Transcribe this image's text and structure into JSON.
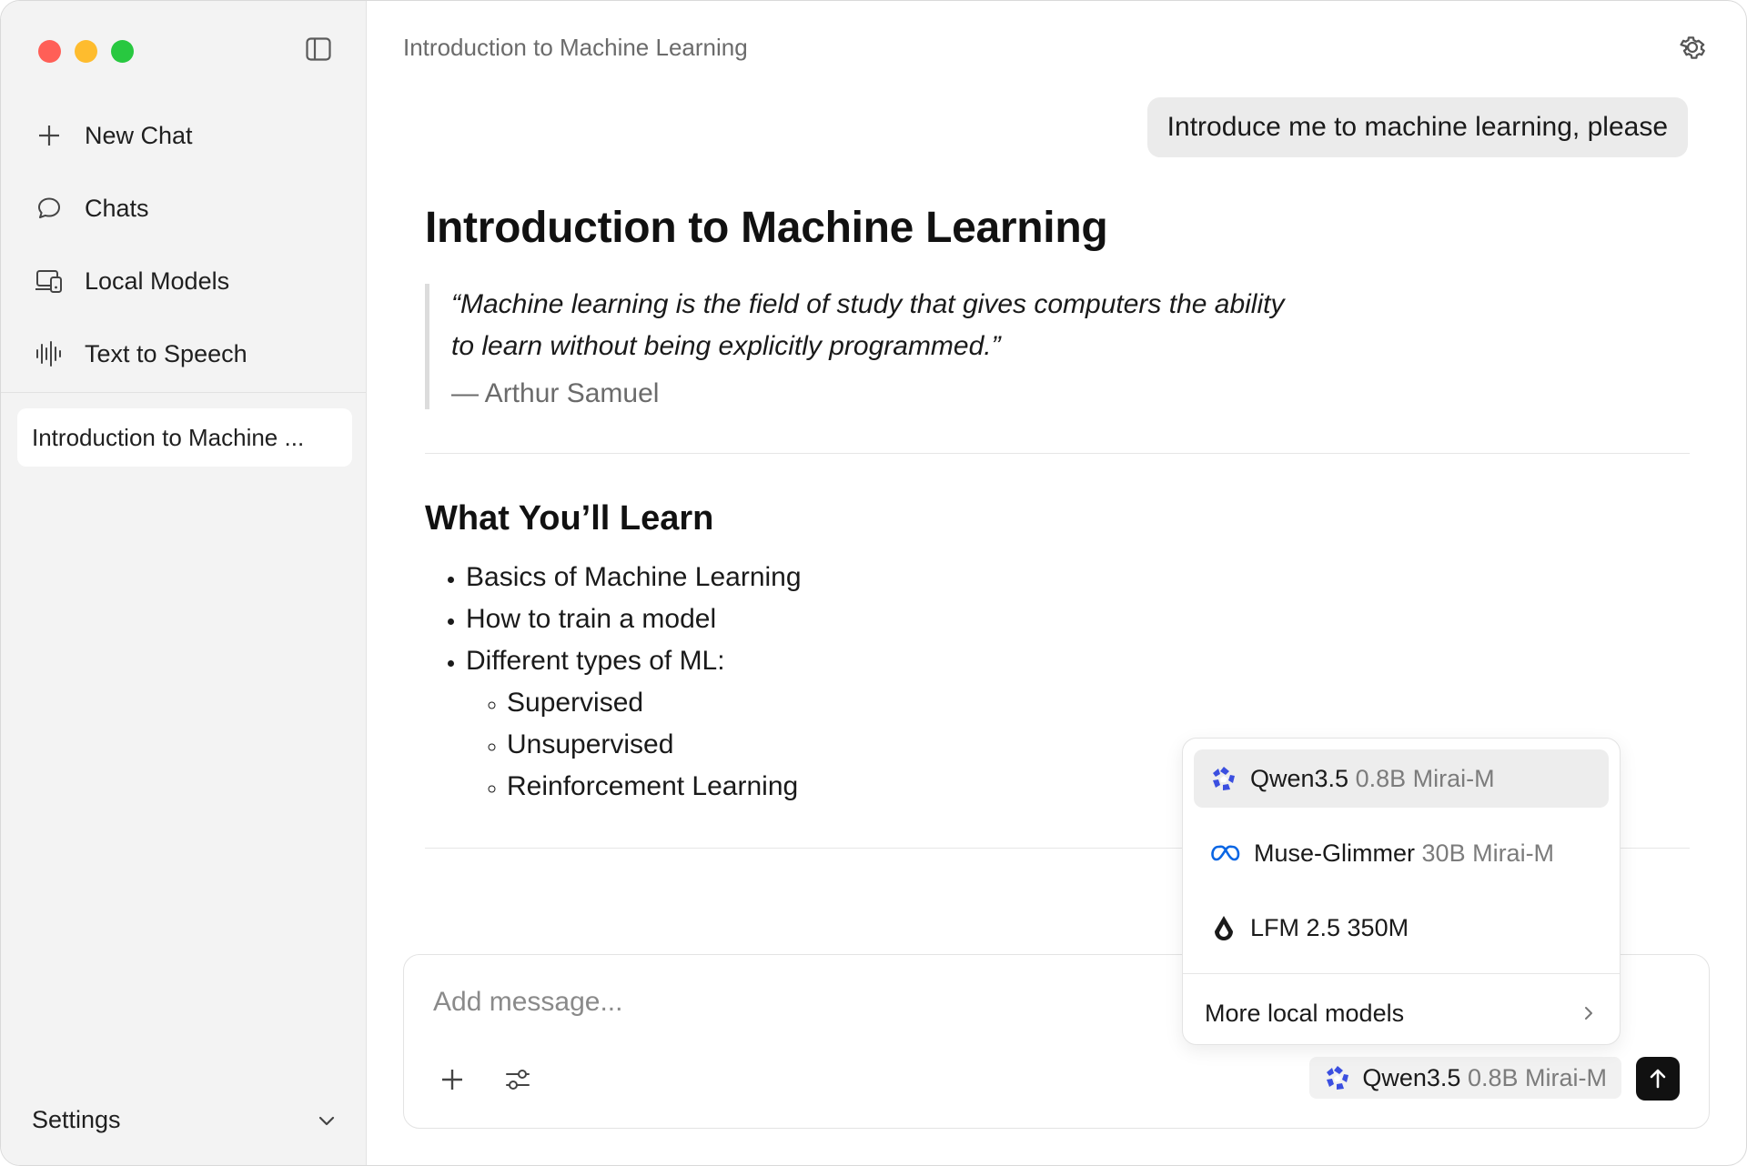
{
  "window": {
    "traffic_lights": {
      "close": "#ff5f57",
      "minimize": "#febc2e",
      "zoom": "#28c840"
    }
  },
  "sidebar": {
    "toggle_icon": "sidebar-icon",
    "items": [
      {
        "label": "New Chat",
        "icon": "plus-icon"
      },
      {
        "label": "Chats",
        "icon": "chat-bubble-icon"
      },
      {
        "label": "Local Models",
        "icon": "devices-icon"
      },
      {
        "label": "Text to Speech",
        "icon": "waveform-icon"
      }
    ],
    "recent_chats": [
      {
        "label": "Introduction to Machine ..."
      }
    ],
    "settings_label": "Settings"
  },
  "header": {
    "title": "Introduction to Machine Learning",
    "settings_icon": "gear-icon"
  },
  "conversation": {
    "user_message": "Introduce me to machine learning, please",
    "response": {
      "heading": "Introduction to Machine Learning",
      "quote_text": "“Machine learning is the field of study that gives computers the ability to learn without being explicitly programmed.”",
      "quote_author": "— Arthur Samuel",
      "section_heading": "What You’ll Learn",
      "bullets": [
        "Basics of Machine Learning",
        "How to train a model",
        "Different types of ML:"
      ],
      "sub_bullets": [
        "Supervised",
        "Unsupervised",
        "Reinforcement Learning"
      ]
    }
  },
  "model_menu": {
    "items": [
      {
        "name": "Qwen3.5",
        "detail": "0.8B Mirai-M",
        "icon": "qwen-icon",
        "selected": true
      },
      {
        "name": "Muse-Glimmer",
        "detail": "30B Mirai-M",
        "icon": "meta-infinity-icon",
        "selected": false
      },
      {
        "name": "LFM 2.5 350M",
        "detail": "",
        "icon": "liquid-drop-icon",
        "selected": false
      }
    ],
    "more_label": "More local models"
  },
  "composer": {
    "placeholder": "Add message...",
    "current_model_name": "Qwen3.5",
    "current_model_detail": "0.8B Mirai-M"
  },
  "colors": {
    "sidebar_bg": "#f3f3f3",
    "user_bubble_bg": "#ebebeb",
    "send_button_bg": "#111111",
    "qwen_icon": "#3b4fe0",
    "meta_icon": "#0a66e4"
  }
}
